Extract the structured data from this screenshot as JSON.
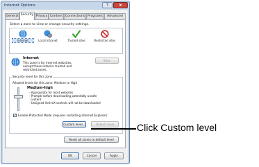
{
  "window": {
    "title": "Internet Options",
    "help_label": "?",
    "close_label": "x"
  },
  "tabs": [
    "General",
    "Security",
    "Privacy",
    "Content",
    "Connections",
    "Programs",
    "Advanced"
  ],
  "zones": {
    "instruction": "Select a zone to view or change security settings.",
    "items": [
      {
        "label": "Internet",
        "icon": "globe-icon",
        "color": "#2f7fcf"
      },
      {
        "label": "Local intranet",
        "icon": "intranet-icon",
        "color": "#3a8fd6"
      },
      {
        "label": "Trusted sites",
        "icon": "checkmark-icon",
        "color": "#3aa335"
      },
      {
        "label": "Restricted sites",
        "icon": "prohibited-icon",
        "color": "#c8262b"
      }
    ],
    "selected": "Internet",
    "heading": "Internet",
    "description_lines": [
      "This zone is for Internet websites,",
      "except those listed in trusted and",
      "restricted zones."
    ],
    "sites_button": "Sites"
  },
  "security_level": {
    "group_label": "Security level for this zone",
    "allowed": "Allowed levels for this zone: Medium to High",
    "level_name": "Medium-high",
    "bullets": [
      "- Appropriate for most websites",
      "- Prompts before downloading potentially unsafe",
      "content",
      "- Unsigned ActiveX controls will not be downloaded"
    ],
    "protected_mode_label": "Enable Protected Mode (requires restarting Internet Explorer)",
    "protected_mode_checked": true,
    "slider_level": "Medium-high",
    "custom_level_button": "Custom level...",
    "default_level_button": "Default level",
    "reset_all_button": "Reset all zones to default level"
  },
  "footer": {
    "ok": "OK",
    "cancel": "Cancel",
    "apply": "Apply"
  },
  "callout": {
    "text": "Click Custom level"
  }
}
